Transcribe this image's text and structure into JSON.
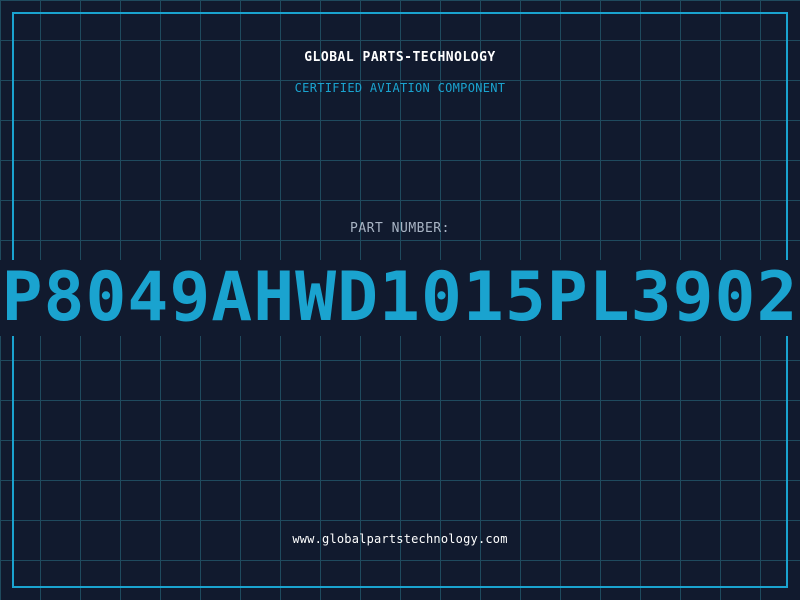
{
  "header": {
    "company": "GLOBAL PARTS-TECHNOLOGY",
    "tagline": "CERTIFIED AVIATION COMPONENT"
  },
  "part": {
    "label": "PART NUMBER:",
    "number": "P8049AHWD1015PL3902"
  },
  "footer": {
    "website": "www.globalpartstechnology.com"
  },
  "colors": {
    "background": "#111a2e",
    "grid": "#1f4a5e",
    "accent": "#1aa3cf",
    "text": "#ffffff",
    "muted": "#a9b4c4"
  }
}
